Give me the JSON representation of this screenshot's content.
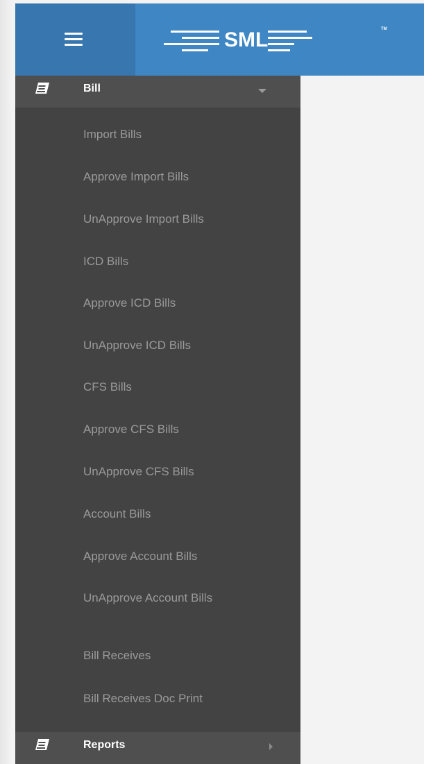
{
  "header": {
    "menu_icon": "hamburger-icon",
    "logo_text": "SML",
    "logo_tm": "TM",
    "colors": {
      "header_bg": "#3f86c4",
      "menu_button_bg": "#3776ae"
    }
  },
  "sidebar": {
    "colors": {
      "bg": "#434343",
      "parent_bg": "#4f4f4f",
      "sub_text": "#9a9a9a"
    },
    "bill": {
      "label": "Bill",
      "icon": "book-icon",
      "expanded": true,
      "items": [
        "Import Bills",
        "Approve Import Bills",
        "UnApprove Import Bills",
        "ICD Bills",
        "Approve ICD Bills",
        "UnApprove ICD Bills",
        "CFS Bills",
        "Approve CFS Bills",
        "UnApprove CFS Bills",
        "Account Bills",
        "Approve Account Bills",
        "UnApprove Account Bills",
        "Bill Receives",
        "Bill Receives Doc Print"
      ]
    },
    "reports": {
      "label": "Reports",
      "icon": "book-icon",
      "expanded": false
    }
  }
}
